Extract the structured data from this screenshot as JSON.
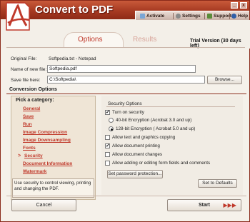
{
  "app": {
    "title": "Convert to PDF"
  },
  "window_controls": {
    "minimize": "_",
    "close": "x"
  },
  "toolbar": {
    "activate": "Activate",
    "settings": "Settings",
    "support": "Support",
    "help": "Help"
  },
  "tabs": {
    "options": "Options",
    "results": "Results"
  },
  "trial": "Trial Version (30 days left)",
  "files": {
    "original_label": "Original File:",
    "original_value": "Softpedia.txt - Notepad",
    "newname_label": "Name of new  file:",
    "newname_value": "Softpedia.pdf",
    "savehere_label": "Save file here:",
    "savehere_value": "C:\\Softpedia\\",
    "browse": "Browse..."
  },
  "conversion_options": "Conversion Options",
  "categories": {
    "header": "Pick a category:",
    "items": [
      "General",
      "Save",
      "Run",
      "Image Compression",
      "Image Downsampling",
      "Fonts",
      "Security",
      "Document Information",
      "Watermark"
    ],
    "selected_marker": ">",
    "description": "Use security to control viewing, printing and changing the PDF."
  },
  "security": {
    "title": "Security Options",
    "turn_on": "Turn on security",
    "enc40": "40-bit Encryption (Acrobat 3.0 and up)",
    "enc128": "128-bit Encryption ( Acrobat 5.0 and up)",
    "allow_copy": "Allow text and graphics copying",
    "allow_print": "Allow document printing",
    "allow_changes": "Allow document changes",
    "allow_forms": "Allow adding or editing form fields and comments",
    "set_password": "Set password protection...",
    "set_defaults": "Set to Defaults"
  },
  "footer": {
    "cancel": "Cancel",
    "start": "Start",
    "start_arrows": "▶▶▶"
  },
  "colors": {
    "accent": "#c0392b",
    "titlebar": "#a63a22"
  }
}
